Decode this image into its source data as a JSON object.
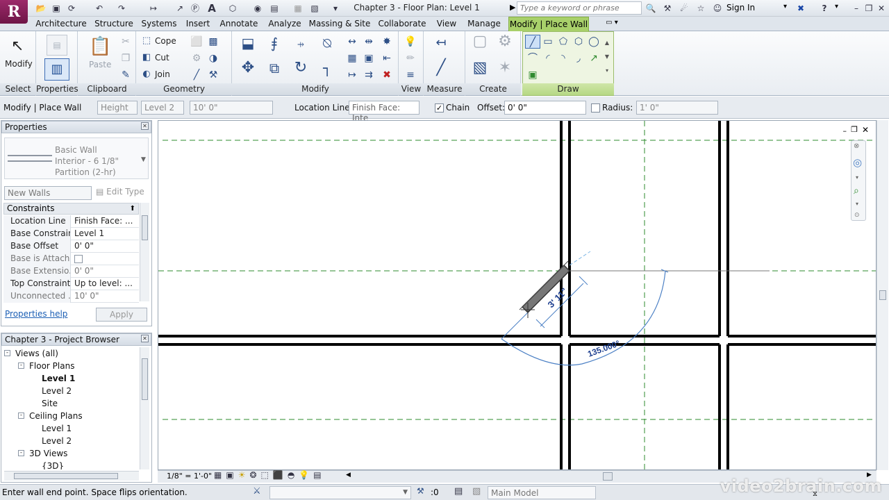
{
  "app": {
    "logo_letter": "R",
    "doc_title": "Chapter 3 - Floor Plan: Level 1"
  },
  "search": {
    "placeholder": "Type a keyword or phrase"
  },
  "signin": {
    "label": "Sign In"
  },
  "tabs": [
    "Architecture",
    "Structure",
    "Systems",
    "Insert",
    "Annotate",
    "Analyze",
    "Massing & Site",
    "Collaborate",
    "View",
    "Manage",
    "Modify | Place Wall"
  ],
  "ribbon": {
    "select": {
      "modify_label": "Modify",
      "panel": "Select"
    },
    "properties": {
      "panel": "Properties"
    },
    "clipboard": {
      "paste": "Paste",
      "panel": "Clipboard"
    },
    "geometry": {
      "cope": "Cope",
      "cut": "Cut",
      "join": "Join",
      "panel": "Geometry"
    },
    "modify": {
      "panel": "Modify"
    },
    "view": {
      "panel": "View"
    },
    "measure": {
      "panel": "Measure"
    },
    "create": {
      "panel": "Create"
    },
    "draw": {
      "panel": "Draw"
    }
  },
  "options_bar": {
    "context": "Modify | Place Wall",
    "height_mode": "Height",
    "height_level": "Level 2",
    "height_value": "10'  0\"",
    "location_line_label": "Location Line:",
    "location_line_value": "Finish Face: Inte",
    "chain_label": "Chain",
    "chain_checked": true,
    "offset_label": "Offset:",
    "offset_value": "0'  0\"",
    "radius_label": "Radius:",
    "radius_checked": false,
    "radius_value": "1'  0\""
  },
  "properties": {
    "title": "Properties",
    "type_family": "Basic Wall",
    "type_name_line1": "Interior - 6 1/8\"",
    "type_name_line2": "Partition (2-hr)",
    "instance_filter": "New Walls",
    "edit_type": "Edit Type",
    "group_header": "Constraints",
    "rows": [
      {
        "key": "Location Line",
        "value": "Finish Face: ...",
        "dim": false
      },
      {
        "key": "Base Constraint",
        "value": "Level 1",
        "dim": false
      },
      {
        "key": "Base Offset",
        "value": "0'  0\"",
        "dim": false
      },
      {
        "key": "Base is Attach...",
        "value": "",
        "dim": true
      },
      {
        "key": "Base Extensio...",
        "value": "0'  0\"",
        "dim": true
      },
      {
        "key": "Top Constraint",
        "value": "Up to level: ...",
        "dim": false
      },
      {
        "key": "Unconnected ...",
        "value": "10'  0\"",
        "dim": true
      }
    ],
    "help_link": "Properties help",
    "apply": "Apply"
  },
  "project_browser": {
    "title": "Chapter 3 - Project Browser",
    "nodes": [
      {
        "label": "Views (all)",
        "indent": 0,
        "toggle": "-",
        "bold": false
      },
      {
        "label": "Floor Plans",
        "indent": 1,
        "toggle": "-",
        "bold": false
      },
      {
        "label": "Level 1",
        "indent": 2,
        "toggle": "",
        "bold": true
      },
      {
        "label": "Level 2",
        "indent": 2,
        "toggle": "",
        "bold": false
      },
      {
        "label": "Site",
        "indent": 2,
        "toggle": "",
        "bold": false
      },
      {
        "label": "Ceiling Plans",
        "indent": 1,
        "toggle": "-",
        "bold": false
      },
      {
        "label": "Level 1",
        "indent": 2,
        "toggle": "",
        "bold": false
      },
      {
        "label": "Level 2",
        "indent": 2,
        "toggle": "",
        "bold": false
      },
      {
        "label": "3D Views",
        "indent": 1,
        "toggle": "-",
        "bold": false
      },
      {
        "label": "{3D}",
        "indent": 2,
        "toggle": "",
        "bold": false
      }
    ]
  },
  "canvas": {
    "wall_length_dim": "3' 11\"",
    "angle_dim": "135.000°"
  },
  "view_control": {
    "scale": "1/8\" = 1'-0\""
  },
  "status": {
    "prompt": "Enter wall end point. Space flips orientation.",
    "selection_count": ":0",
    "workset": "Main Model"
  },
  "watermark": "video2brain.com"
}
